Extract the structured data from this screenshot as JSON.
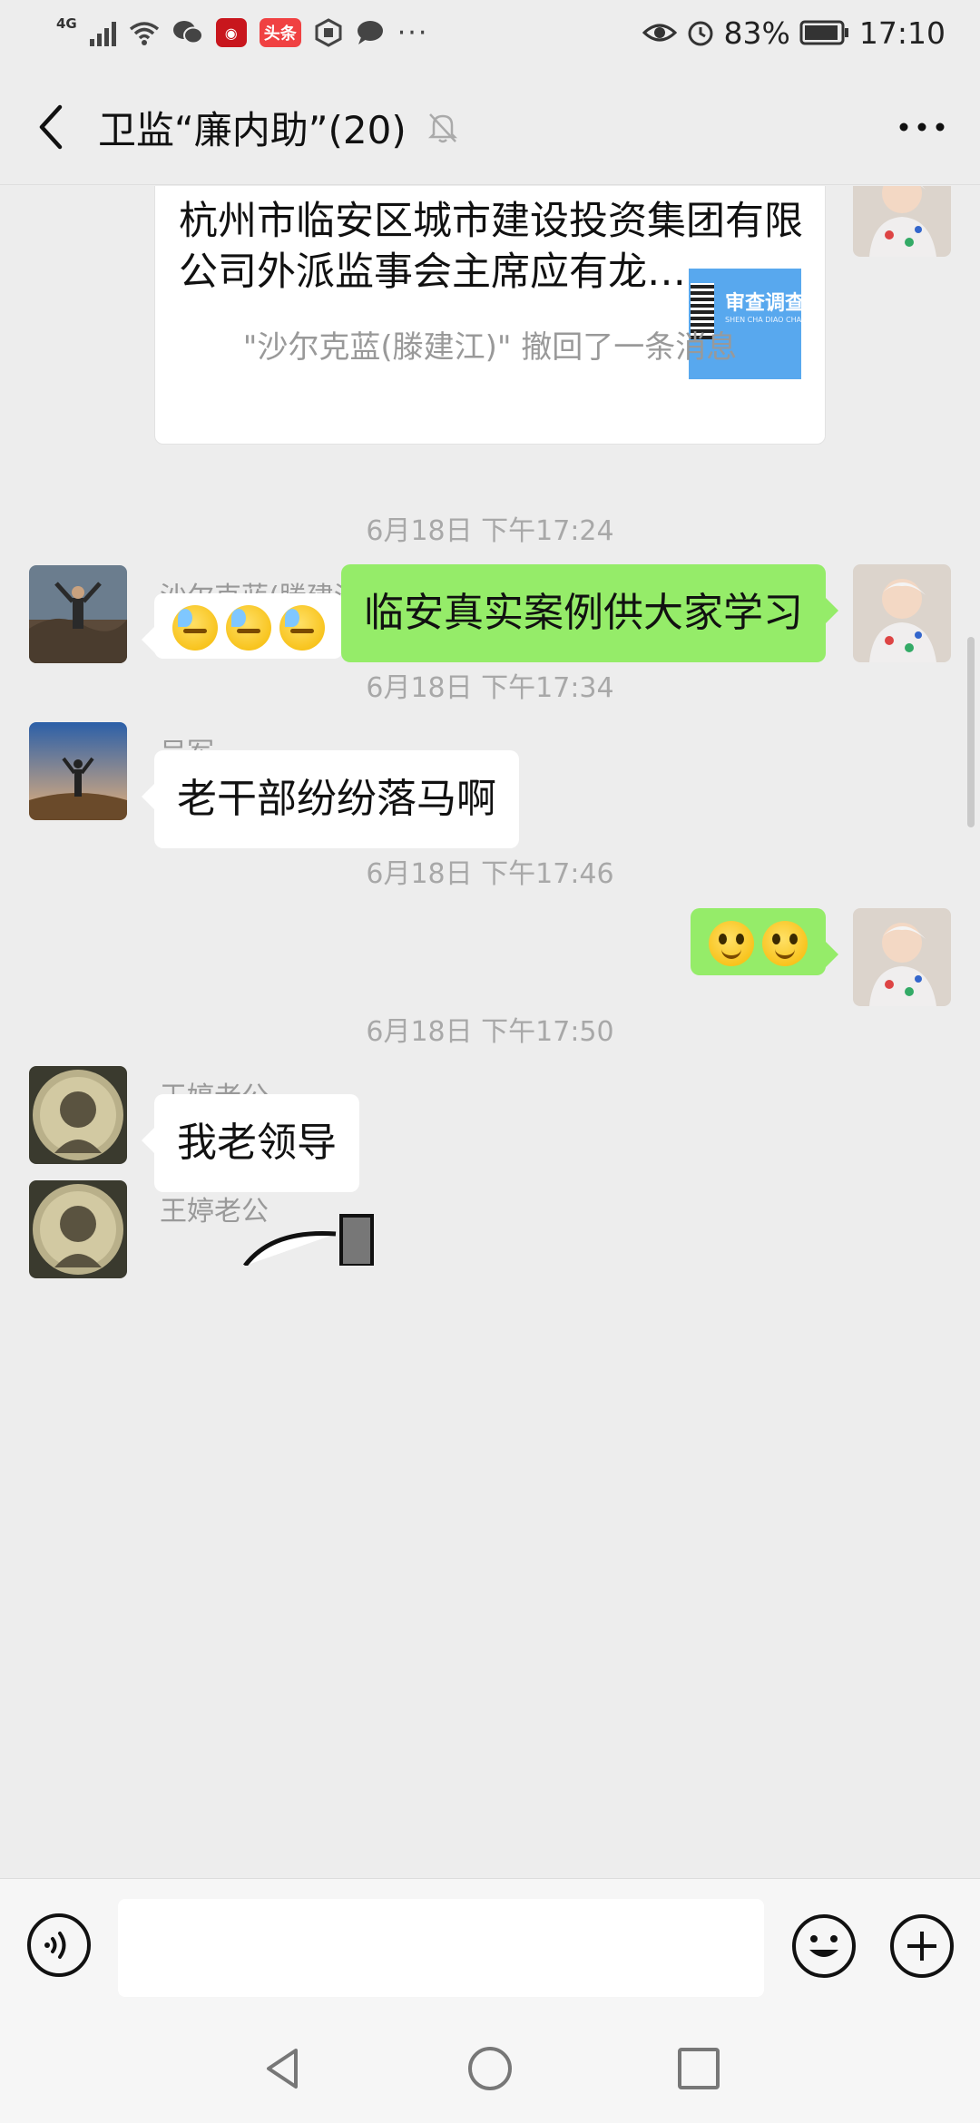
{
  "status_bar": {
    "network": "4G",
    "app_badge_toutiao": "头条",
    "more": "···",
    "battery": "83%",
    "time": "17:10"
  },
  "nav": {
    "title": "卫监“廉内助”(20)"
  },
  "messages": {
    "card": {
      "text": "杭州市临安区城市建设投资集团有限公司外派监事会主席应有龙…",
      "thumb_title": "审查调查",
      "thumb_sub": "SHEN CHA DIAO CHA"
    },
    "recall_notice": "\"沙尔克蓝(滕建江)\" 撤回了一条消息",
    "sender1": "沙尔克蓝(滕建江)",
    "time1": "6月18日 下午17:24",
    "out1": "临安真实案例供大家学习",
    "time2": "6月18日 下午17:34",
    "sender2": "吴军",
    "in2": "老干部纷纷落马啊",
    "time3": "6月18日 下午17:46",
    "time4": "6月18日 下午17:50",
    "sender3": "王婷老公",
    "in3": "我老领导",
    "sender4": "王婷老公"
  },
  "input": {
    "value": "",
    "placeholder": ""
  },
  "colors": {
    "outgoing_bubble": "#95ec69",
    "incoming_bubble": "#ffffff",
    "background": "#ededed"
  }
}
